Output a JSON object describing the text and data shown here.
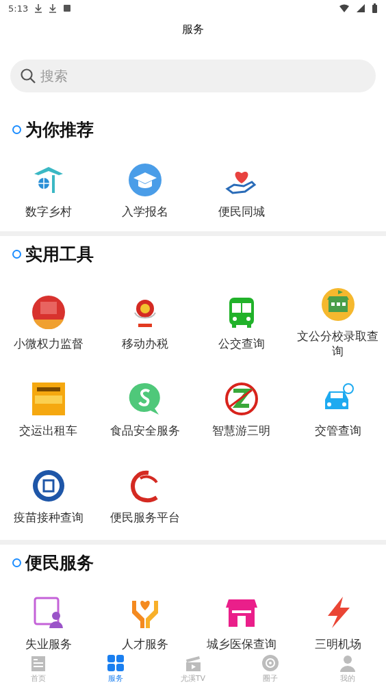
{
  "status_bar": {
    "time": "5:13"
  },
  "header": {
    "title": "服务"
  },
  "search": {
    "placeholder": "搜索"
  },
  "sections": [
    {
      "title": "为你推荐",
      "items": [
        {
          "label": "数字乡村"
        },
        {
          "label": "入学报名"
        },
        {
          "label": "便民同城"
        }
      ]
    },
    {
      "title": "实用工具",
      "items": [
        {
          "label": "小微权力监督"
        },
        {
          "label": "移动办税"
        },
        {
          "label": "公交查询"
        },
        {
          "label": "文公分校录取查询"
        },
        {
          "label": "交运出租车"
        },
        {
          "label": "食品安全服务"
        },
        {
          "label": "智慧游三明"
        },
        {
          "label": "交管查询"
        },
        {
          "label": "疫苗接种查询"
        },
        {
          "label": "便民服务平台"
        }
      ]
    },
    {
      "title": "便民服务",
      "items": [
        {
          "label": "失业服务"
        },
        {
          "label": "人才服务"
        },
        {
          "label": "城乡医保查询"
        },
        {
          "label": "三明机场"
        }
      ]
    }
  ],
  "tab_bar": [
    {
      "label": "首页",
      "selected": false
    },
    {
      "label": "服务",
      "selected": true
    },
    {
      "label": "尤溪TV",
      "selected": false
    },
    {
      "label": "圈子",
      "selected": false
    },
    {
      "label": "我的",
      "selected": false
    }
  ]
}
